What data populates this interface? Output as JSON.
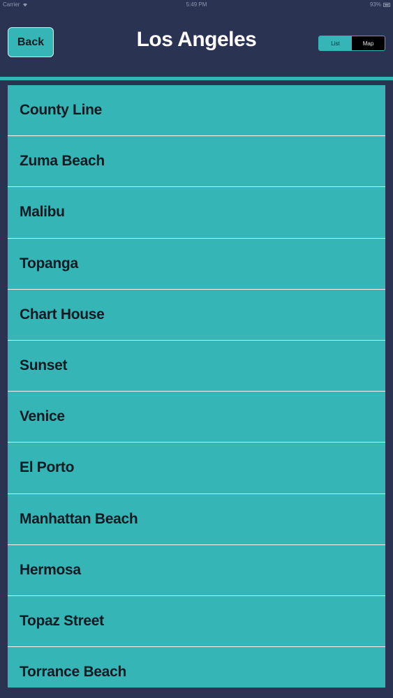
{
  "status": {
    "carrier": "Carrier",
    "time": "5:49 PM",
    "battery": "93%"
  },
  "nav": {
    "back_label": "Back",
    "title": "Los Angeles",
    "segments": [
      "List",
      "Map"
    ],
    "selected_segment": "List"
  },
  "beaches": [
    "County Line",
    "Zuma Beach",
    "Malibu",
    "Topanga",
    "Chart House",
    "Sunset",
    "Venice",
    "El Porto",
    "Manhattan Beach",
    "Hermosa",
    "Topaz Street",
    "Torrance Beach"
  ],
  "colors": {
    "background": "#2a3352",
    "accent": "#35b5b5",
    "text_dark": "#0f1a22",
    "title": "#ffffff"
  }
}
